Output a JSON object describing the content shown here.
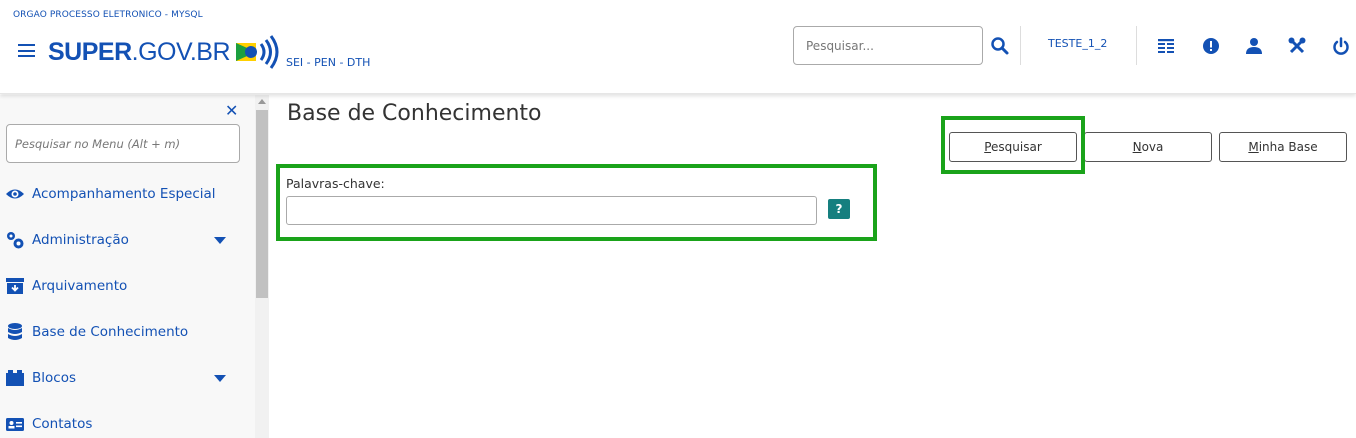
{
  "header": {
    "org_name": "ORGAO PROCESSO ELETRONICO - MYSQL",
    "logo_text_bold": "SUPER",
    "logo_text_rest": ".GOV.BR",
    "system_subtitle": "SEI - PEN - DTH",
    "search_placeholder": "Pesquisar...",
    "unit": "TESTE_1_2",
    "icons": [
      "menu-icon",
      "search-icon",
      "list-icon",
      "alert-icon",
      "user-icon",
      "tools-icon",
      "power-icon"
    ]
  },
  "sidebar": {
    "menu_search_placeholder": "Pesquisar no Menu (Alt + m)",
    "items": [
      {
        "label": "Acompanhamento Especial",
        "icon": "eye-icon",
        "has_caret": false
      },
      {
        "label": "Administração",
        "icon": "gears-icon",
        "has_caret": true
      },
      {
        "label": "Arquivamento",
        "icon": "archive-icon",
        "has_caret": false
      },
      {
        "label": "Base de Conhecimento",
        "icon": "database-icon",
        "has_caret": false
      },
      {
        "label": "Blocos",
        "icon": "blocks-icon",
        "has_caret": true
      },
      {
        "label": "Contatos",
        "icon": "contact-card-icon",
        "has_caret": false
      }
    ]
  },
  "main": {
    "title": "Base de Conhecimento",
    "buttons": {
      "pesquisar_first": "P",
      "pesquisar_rest": "esquisar",
      "nova_first": "N",
      "nova_rest": "ova",
      "minha_first": "M",
      "minha_rest": "inha Base"
    },
    "field_label": "Palavras-chave:",
    "field_value": "",
    "help_label": "?"
  },
  "colors": {
    "brand_blue": "#1351b4",
    "highlight_green": "#1aa31a",
    "help_teal": "#157f7f"
  }
}
